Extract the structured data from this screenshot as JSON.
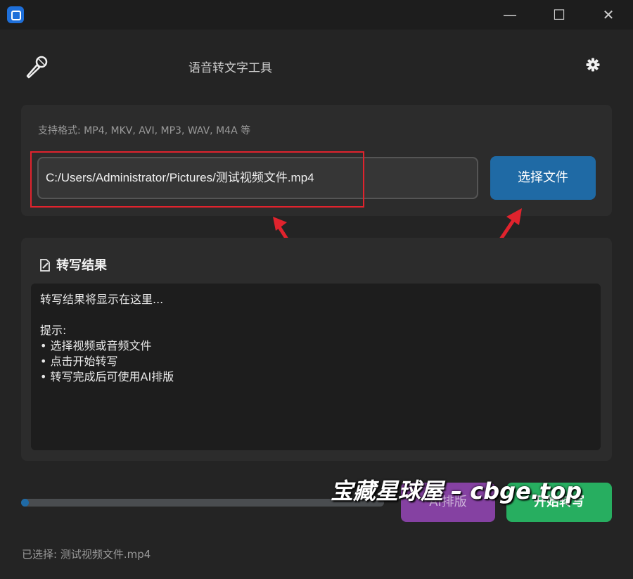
{
  "window": {
    "minimize_label": "—",
    "maximize_label": "☐",
    "close_label": "✕"
  },
  "header": {
    "title": "语音转文字工具",
    "logo_icon": "microphone-icon",
    "settings_icon": "gear-icon"
  },
  "file": {
    "formats_text": "支持格式: MP4, MKV, AVI, MP3, WAV, M4A 等",
    "path_value": "C:/Users/Administrator/Pictures/测试视频文件.mp4",
    "choose_label": "选择文件"
  },
  "result": {
    "title": "转写结果",
    "lines": [
      "转写结果将显示在这里...",
      "",
      "提示:",
      "• 选择视频或音频文件",
      "• 点击开始转写",
      "• 转写完成后可使用AI排版"
    ]
  },
  "actions": {
    "progress": 0.02,
    "ai_label": "AI排版",
    "start_label": "开始转写"
  },
  "watermark": "宝藏星球屋 – cbge.top",
  "status": "已选择: 测试视频文件.mp4",
  "colors": {
    "accent": "#1f6aa5",
    "ai": "#8e44ad",
    "start": "#27ae60",
    "annotation": "#e0232d"
  }
}
